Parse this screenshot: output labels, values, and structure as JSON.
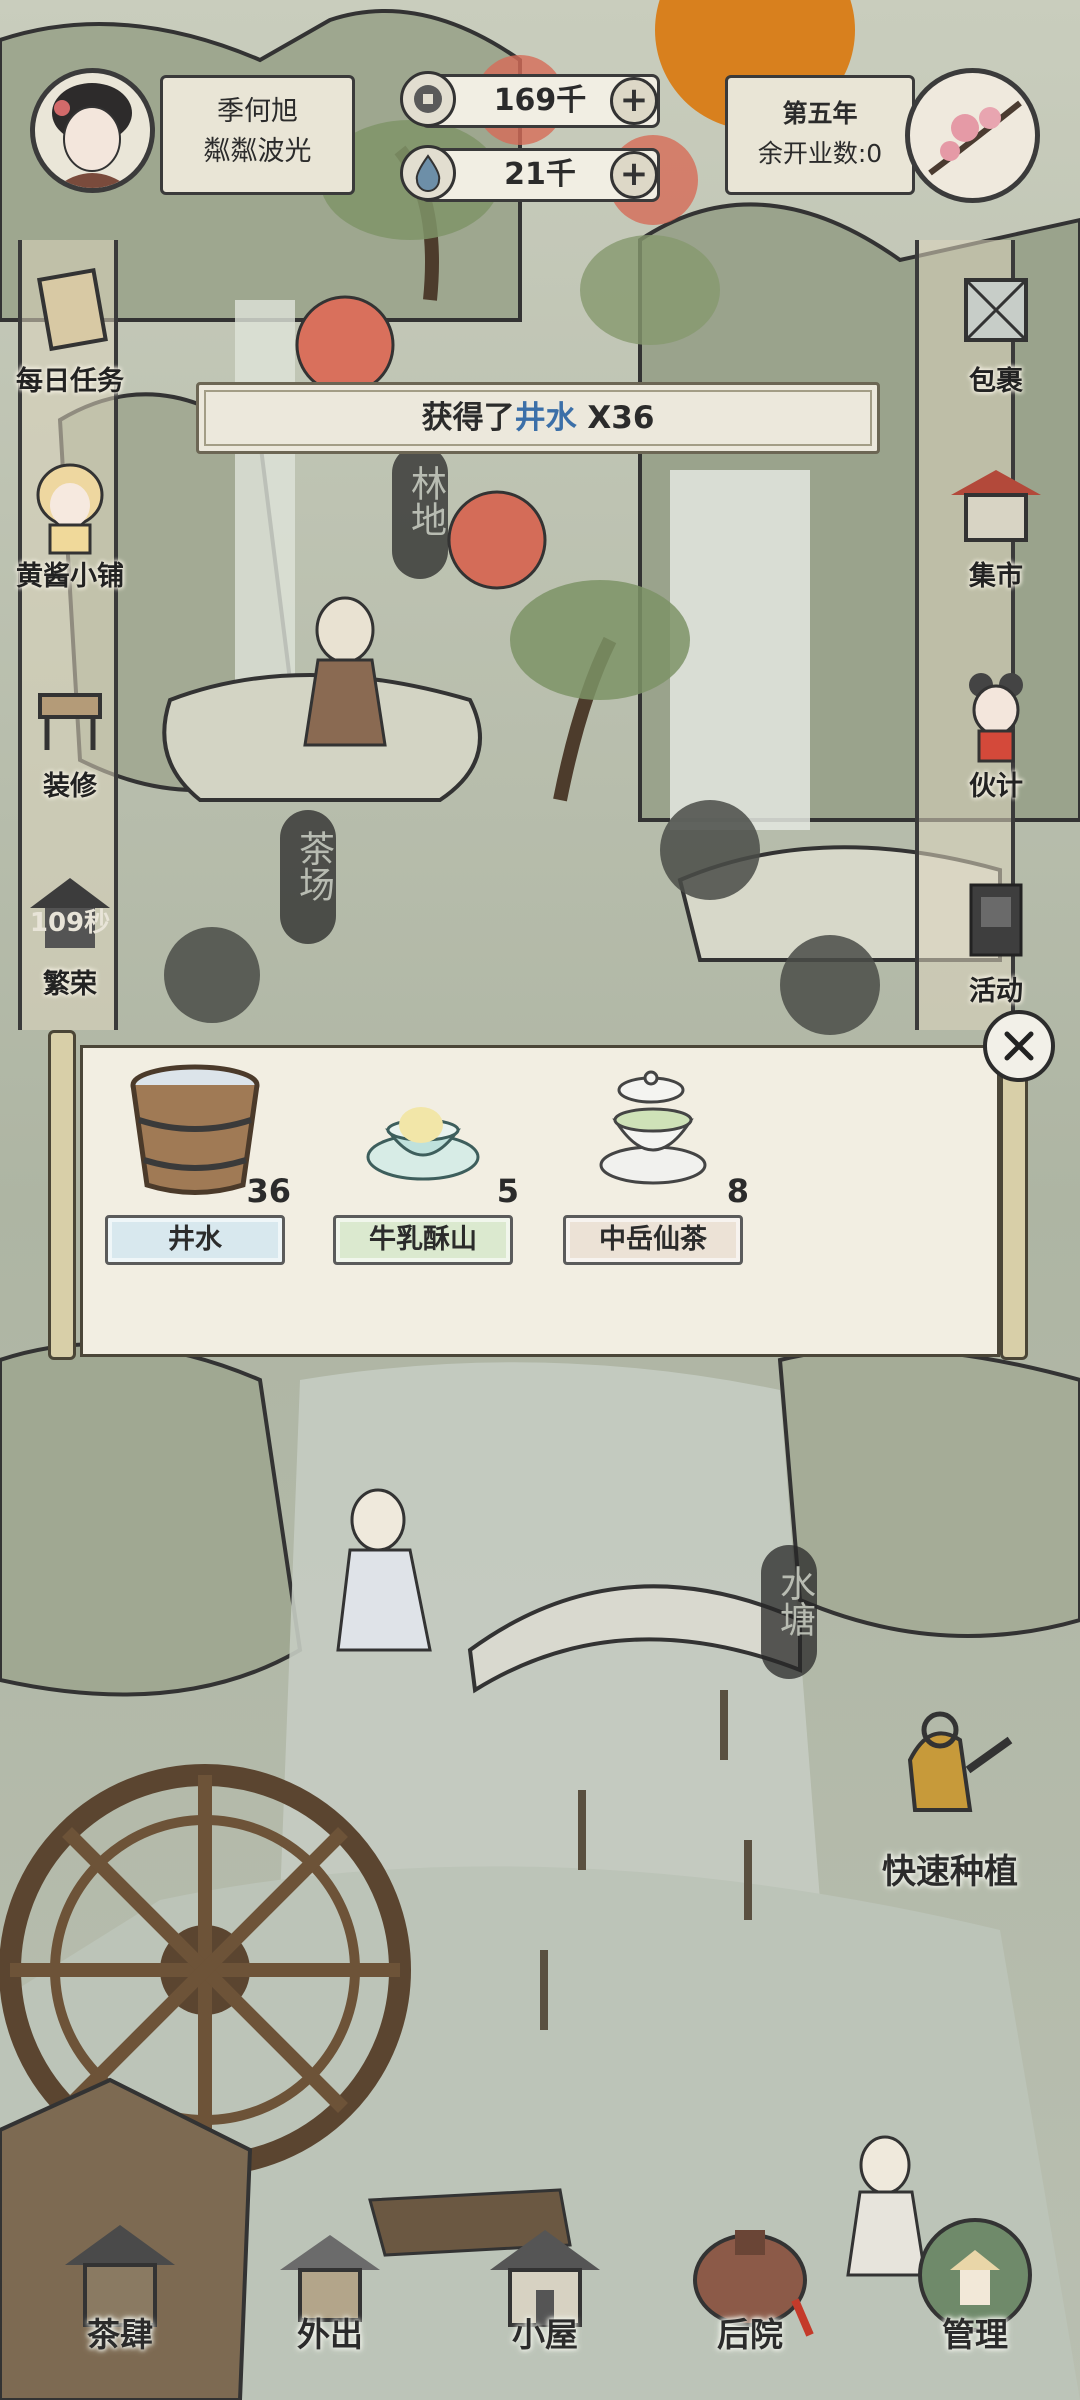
{
  "player": {
    "name": "季何旭",
    "title": "粼粼波光"
  },
  "resources": [
    {
      "icon": "coin-icon",
      "value": "169千"
    },
    {
      "icon": "water-drop-icon",
      "value": "21千"
    }
  ],
  "season": {
    "year": "第五年",
    "openings": "余开业数:0"
  },
  "banner": {
    "prefix": "获得了",
    "item": "井水",
    "suffix": " X36"
  },
  "left_menu": [
    {
      "label": "每日任务",
      "icon": "scroll-icon"
    },
    {
      "label": "黄酱小铺",
      "icon": "shop-girl-icon"
    },
    {
      "label": "装修",
      "icon": "chair-icon"
    },
    {
      "label": "繁荣",
      "icon": "pagoda-icon",
      "timer": "109秒"
    }
  ],
  "right_menu": [
    {
      "label": "包裹",
      "icon": "bundle-icon"
    },
    {
      "label": "集市",
      "icon": "market-icon"
    },
    {
      "label": "伙计",
      "icon": "worker-icon"
    },
    {
      "label": "活动",
      "icon": "event-scroll-icon"
    }
  ],
  "locations": {
    "forest": "林地",
    "tea_field": "茶场",
    "pond": "水塘"
  },
  "rewards": [
    {
      "name": "井水",
      "count": "36",
      "icon": "wooden-bucket-icon",
      "label_color": "#d8e8ee"
    },
    {
      "name": "牛乳酥山",
      "count": "5",
      "icon": "milk-dessert-icon",
      "label_color": "#dbe9cf"
    },
    {
      "name": "中岳仙茶",
      "count": "8",
      "icon": "tea-bowl-icon",
      "label_color": "#ece2d6"
    }
  ],
  "quick_plant": {
    "label": "快速种植"
  },
  "bottom_nav": [
    {
      "label": "茶肆",
      "icon": "teahouse-icon"
    },
    {
      "label": "外出",
      "icon": "travel-icon"
    },
    {
      "label": "小屋",
      "icon": "cottage-icon"
    },
    {
      "label": "后院",
      "icon": "backyard-icon"
    },
    {
      "label": "管理",
      "icon": "manage-icon"
    }
  ],
  "colors": {
    "accent_blue": "#3b6fa8",
    "sun": "#d8801e",
    "ink": "#2b2b2b",
    "paper": "#f2eee2"
  }
}
